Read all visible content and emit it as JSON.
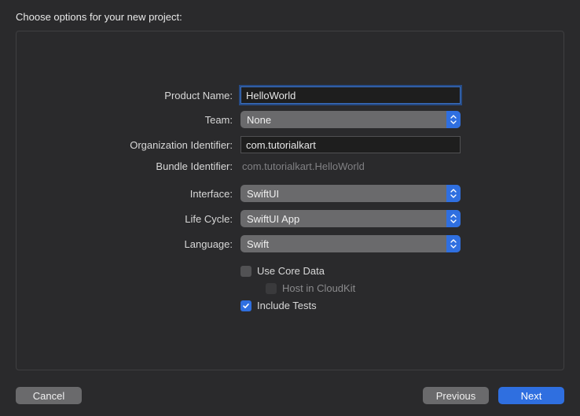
{
  "sheet": {
    "title": "Choose options for your new project:"
  },
  "form": {
    "product_name": {
      "label": "Product Name:",
      "value": "HelloWorld"
    },
    "team": {
      "label": "Team:",
      "value": "None"
    },
    "org_identifier": {
      "label": "Organization Identifier:",
      "value": "com.tutorialkart"
    },
    "bundle_identifier": {
      "label": "Bundle Identifier:",
      "value": "com.tutorialkart.HelloWorld"
    },
    "interface": {
      "label": "Interface:",
      "value": "SwiftUI"
    },
    "life_cycle": {
      "label": "Life Cycle:",
      "value": "SwiftUI App"
    },
    "language": {
      "label": "Language:",
      "value": "Swift"
    },
    "use_core_data": {
      "label": "Use Core Data",
      "checked": false
    },
    "host_in_cloudkit": {
      "label": "Host in CloudKit",
      "checked": false,
      "enabled": false
    },
    "include_tests": {
      "label": "Include Tests",
      "checked": true
    }
  },
  "footer": {
    "cancel": "Cancel",
    "previous": "Previous",
    "next": "Next"
  },
  "colors": {
    "accent": "#2f6fe0",
    "background": "#2a2a2c",
    "control": "#6a6a6c"
  }
}
